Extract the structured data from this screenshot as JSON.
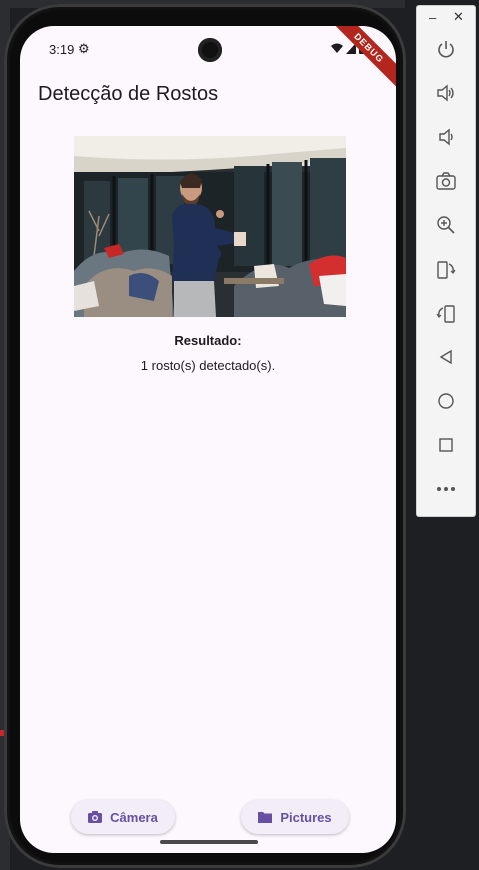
{
  "status_bar": {
    "time": "3:19"
  },
  "debug_banner": "DEBUG",
  "app_bar": {
    "title": "Detecção de Rostos"
  },
  "result": {
    "label": "Resultado:",
    "text": "1 rosto(s) detectado(s)."
  },
  "buttons": {
    "camera": "Câmera",
    "pictures": "Pictures"
  },
  "colors": {
    "background": "#fdf7fe",
    "accent": "#6750a4",
    "button_bg": "#f3edf7"
  },
  "emulator_toolbar": {
    "items": [
      "power-icon",
      "volume-up-icon",
      "volume-down-icon",
      "screenshot-icon",
      "zoom-icon",
      "rotate-left-icon",
      "rotate-right-icon",
      "back-icon",
      "home-icon",
      "overview-icon",
      "more-icon"
    ]
  }
}
